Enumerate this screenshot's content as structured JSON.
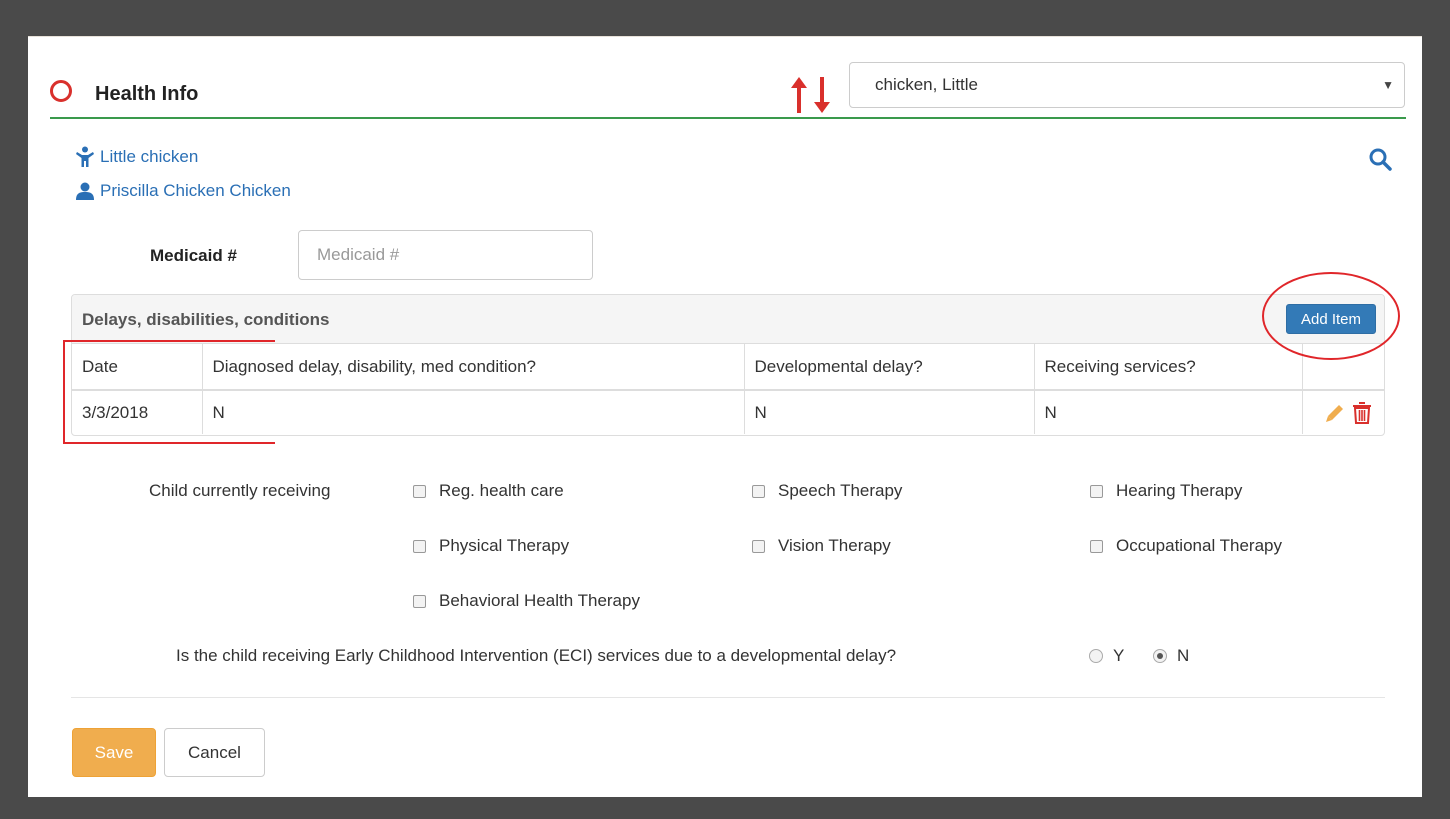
{
  "header": {
    "title": "Health Info",
    "selected_child": "chicken, Little",
    "status_color": "#d9302c",
    "accent_rule_color": "#3a9a4c"
  },
  "people": {
    "child_name": "Little chicken",
    "parent_name": "Priscilla Chicken Chicken"
  },
  "medicaid": {
    "label": "Medicaid #",
    "placeholder": "Medicaid #",
    "value": ""
  },
  "conditions_panel": {
    "title": "Delays, disabilities, conditions",
    "add_label": "Add Item",
    "columns": [
      "Date",
      "Diagnosed delay, disability, med condition?",
      "Developmental delay?",
      "Receiving services?",
      ""
    ],
    "rows": [
      {
        "date": "3/3/2018",
        "diagnosed": "N",
        "developmental": "N",
        "receiving": "N"
      }
    ]
  },
  "services": {
    "label": "Child currently receiving",
    "options": [
      {
        "label": "Reg. health care",
        "checked": false
      },
      {
        "label": "Speech Therapy",
        "checked": false
      },
      {
        "label": "Hearing Therapy",
        "checked": false
      },
      {
        "label": "Physical Therapy",
        "checked": false
      },
      {
        "label": "Vision Therapy",
        "checked": false
      },
      {
        "label": "Occupational Therapy",
        "checked": false
      },
      {
        "label": "Behavioral Health Therapy",
        "checked": false
      }
    ]
  },
  "eci": {
    "question": "Is the child receiving Early Childhood Intervention (ECI) services due to a developmental delay?",
    "yes_label": "Y",
    "no_label": "N",
    "selected": "N"
  },
  "footer": {
    "save_label": "Save",
    "cancel_label": "Cancel"
  },
  "icons": {
    "status": "circle-outline-icon",
    "sort": "sort-up-down-arrows-icon",
    "child": "child-icon",
    "parent": "user-icon",
    "search": "search-icon",
    "edit": "pencil-icon",
    "delete": "trash-icon"
  }
}
